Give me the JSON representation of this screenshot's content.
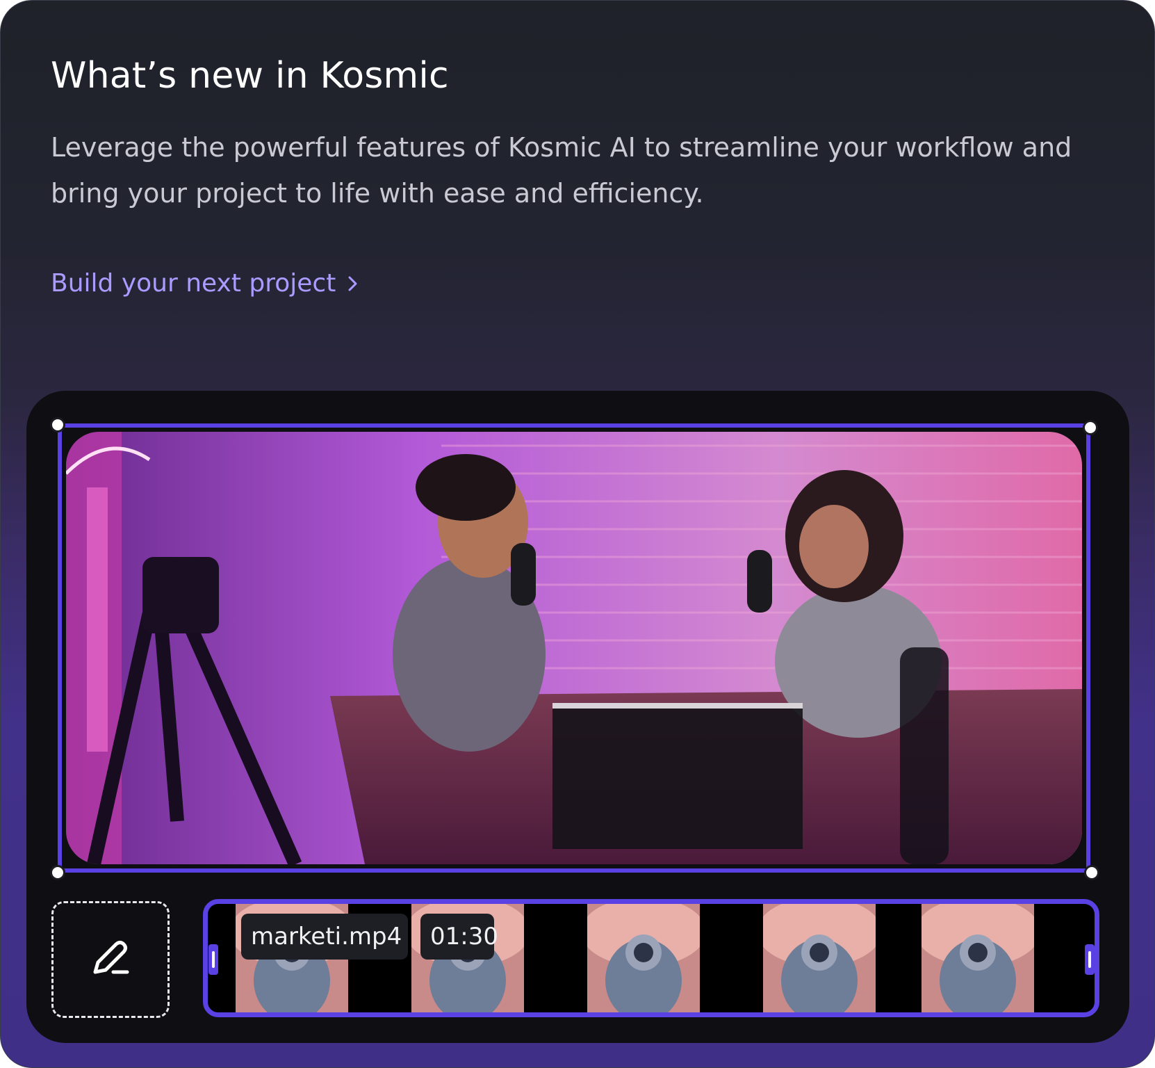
{
  "card": {
    "title": "What’s new in Kosmic",
    "description": "Leverage the powerful features of Kosmic AI to streamline your workflow and bring your project to life with ease and efficiency.",
    "cta_label": "Build your next project",
    "cta_icon": "chevron-right-icon"
  },
  "editor": {
    "preview_image": "podcast-studio-photo",
    "edit_icon": "pencil-icon",
    "clip": {
      "filename": "marketi.mp4",
      "duration": "01:30",
      "thumbnail": "astronaut-in-clouds"
    }
  },
  "colors": {
    "accent": "#5a41e3",
    "link": "#a99bff",
    "background_top": "#1f2229",
    "background_bottom": "#42318a"
  }
}
